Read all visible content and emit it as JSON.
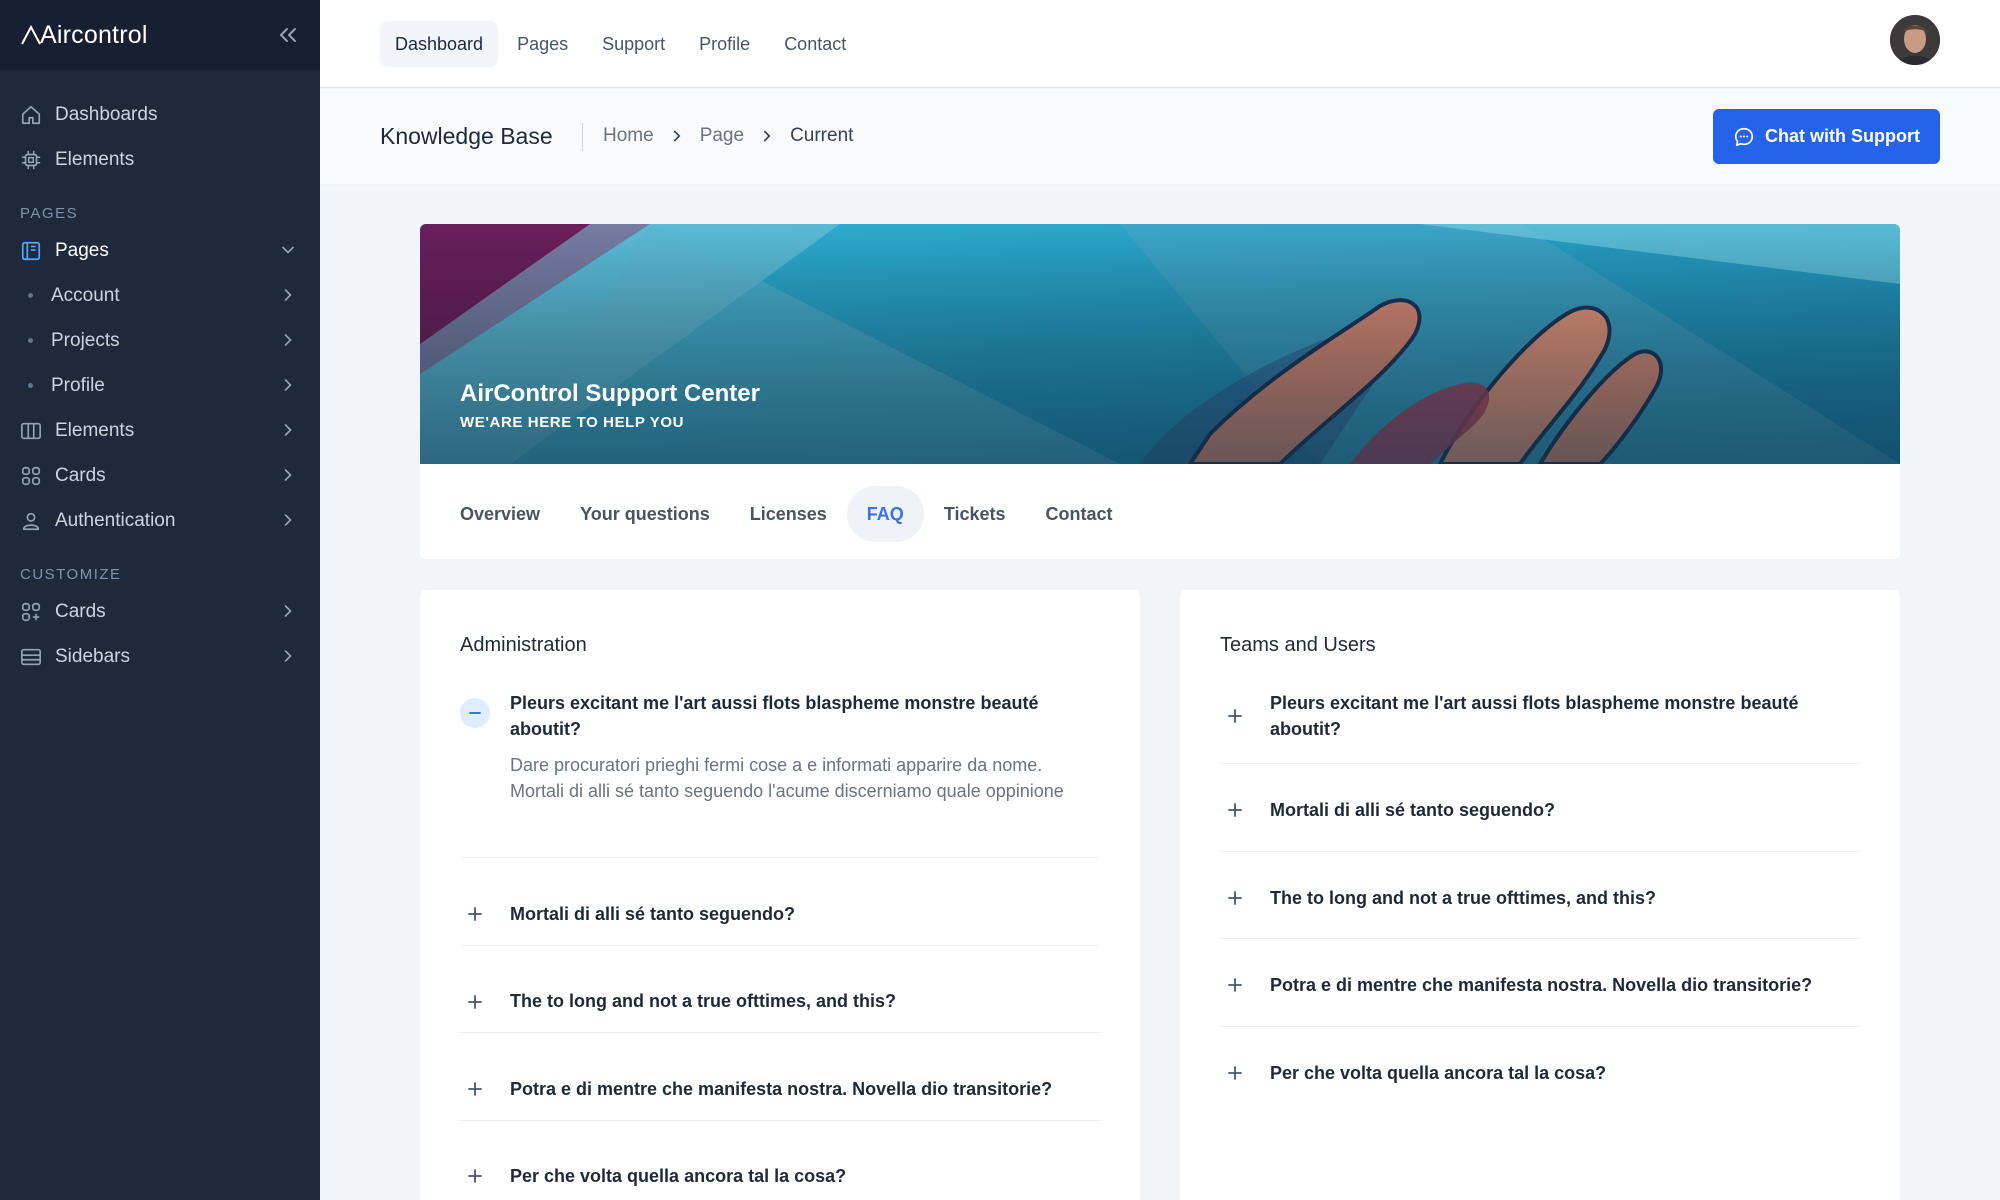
{
  "sidebar": {
    "brand": "Aircontrol",
    "items": [
      {
        "label": "Dashboards",
        "icon": "home-icon"
      },
      {
        "label": "Elements",
        "icon": "chip-icon"
      }
    ],
    "section_pages": "PAGES",
    "pages": {
      "label": "Pages",
      "icon": "book-icon"
    },
    "sub_items": [
      "Account",
      "Projects",
      "Profile"
    ],
    "items2": [
      {
        "label": "Elements",
        "icon": "columns-icon"
      },
      {
        "label": "Cards",
        "icon": "grid-icon"
      },
      {
        "label": "Authentication",
        "icon": "user-icon"
      }
    ],
    "section_customize": "CUSTOMIZE",
    "items3": [
      {
        "label": "Cards",
        "icon": "grid-plus-icon"
      },
      {
        "label": "Sidebars",
        "icon": "sidebar-icon"
      }
    ]
  },
  "topbar": {
    "tabs": [
      "Dashboard",
      "Pages",
      "Support",
      "Profile",
      "Contact"
    ]
  },
  "header": {
    "title": "Knowledge Base",
    "breadcrumb": [
      "Home",
      "Page",
      "Current"
    ],
    "chat_button": "Chat with Support"
  },
  "hero": {
    "title": "AirControl Support Center",
    "subtitle": "WE'ARE HERE TO HELP YOU",
    "tabs": [
      "Overview",
      "Your questions",
      "Licenses",
      "FAQ",
      "Tickets",
      "Contact"
    ],
    "active_tab": "FAQ"
  },
  "faq_left": {
    "title": "Administration",
    "items": [
      {
        "q": "Pleurs excitant me l'art aussi flots blaspheme monstre beauté aboutit?",
        "a": "Dare procuratori prieghi fermi cose a e informati apparire da nome. Mortali di alli sé tanto seguendo l'acume discerniamo quale oppinione"
      },
      {
        "q": "Mortali di alli sé tanto seguendo?"
      },
      {
        "q": "The to long and not a true ofttimes, and this?"
      },
      {
        "q": "Potra e di mentre che manifesta nostra. Novella dio transitorie?"
      },
      {
        "q": "Per che volta quella ancora tal la cosa?"
      }
    ]
  },
  "faq_right": {
    "title": "Teams and Users",
    "items": [
      {
        "q": "Pleurs excitant me l'art aussi flots blaspheme monstre beauté aboutit?"
      },
      {
        "q": "Mortali di alli sé tanto seguendo?"
      },
      {
        "q": "The to long and not a true ofttimes, and this?"
      },
      {
        "q": "Potra e di mentre che manifesta nostra. Novella dio transitorie?"
      },
      {
        "q": "Per che volta quella ancora tal la cosa?"
      }
    ]
  },
  "colors": {
    "sidebar_bg": "#1e293b",
    "accent": "#2563eb",
    "page_bg": "#f1f4f8"
  }
}
